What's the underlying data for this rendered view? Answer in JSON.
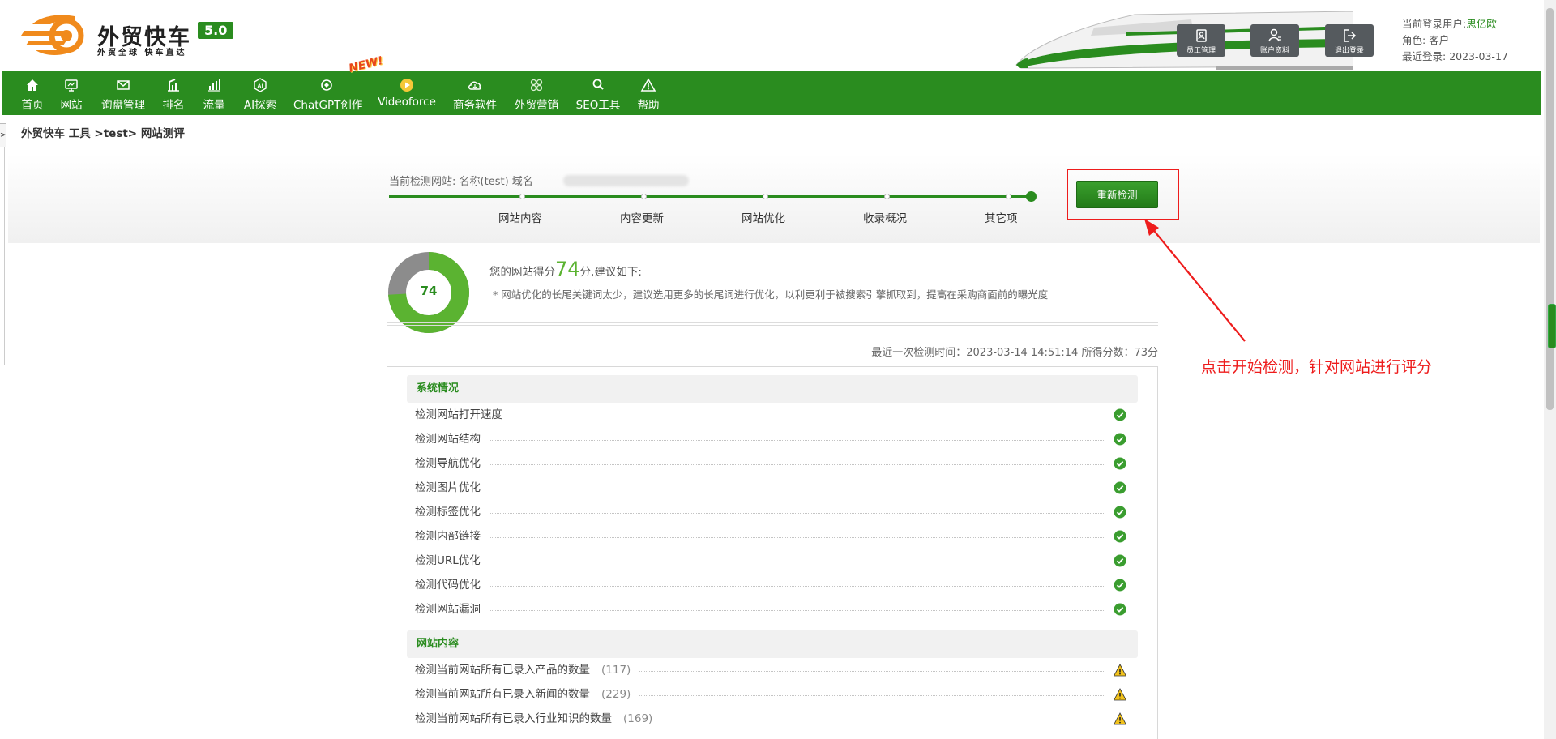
{
  "brand": {
    "name": "外贸快车",
    "version": "5.0",
    "slogan": "外贸全球 快车直达"
  },
  "header_buttons": [
    {
      "label": "员工管理",
      "icon": "staff-icon"
    },
    {
      "label": "账户资料",
      "icon": "account-icon"
    },
    {
      "label": "退出登录",
      "icon": "logout-icon"
    }
  ],
  "user": {
    "login_label": "当前登录用户:",
    "login_name": "思亿欧",
    "role_label": "角色:",
    "role": "客户",
    "last_login_label": "最近登录:",
    "last_login": "2023-03-17"
  },
  "nav": [
    {
      "label": "首页",
      "icon": "home-icon"
    },
    {
      "label": "网站",
      "icon": "monitor-icon"
    },
    {
      "label": "询盘管理",
      "icon": "mail-icon"
    },
    {
      "label": "排名",
      "icon": "ranking-icon"
    },
    {
      "label": "流量",
      "icon": "bar-chart-icon"
    },
    {
      "label": "AI探索",
      "icon": "ai-icon"
    },
    {
      "label": "ChatGPT创作",
      "icon": "chatgpt-icon"
    },
    {
      "label": "Videoforce",
      "icon": "video-icon"
    },
    {
      "label": "商务软件",
      "icon": "cloud-icon"
    },
    {
      "label": "外贸营销",
      "icon": "marketing-icon"
    },
    {
      "label": "SEO工具",
      "icon": "search-icon"
    },
    {
      "label": "帮助",
      "icon": "warning-icon"
    }
  ],
  "new_badge": "NEW!",
  "side_tab": ">",
  "breadcrumb": "外贸快车 工具 >test> 网站测评",
  "current_site": {
    "label": "当前检测网站:",
    "name_label": "名称",
    "name": "(test)",
    "domain_label": "域名"
  },
  "steps": [
    "网站内容",
    "内容更新",
    "网站优化",
    "收录概况",
    "其它项"
  ],
  "recheck_button": "重新检测",
  "annotation": "点击开始检测，针对网站进行评分",
  "score": {
    "value": 74,
    "prefix": "您的网站得分",
    "suffix": "分,建议如下:",
    "suggestion": "* 网站优化的长尾关键词太少，建议选用更多的长尾词进行优化，以利更利于被搜索引擎抓取到，提高在采购商面前的曝光度"
  },
  "last_check": "最近一次检测时间：2023-03-14 14:51:14 所得分数：73分",
  "sections": [
    {
      "title": "系统情况",
      "items": [
        {
          "label": "检测网站打开速度",
          "status": "ok"
        },
        {
          "label": "检测网站结构",
          "status": "ok"
        },
        {
          "label": "检测导航优化",
          "status": "ok"
        },
        {
          "label": "检测图片优化",
          "status": "ok"
        },
        {
          "label": "检测标签优化",
          "status": "ok"
        },
        {
          "label": "检测内部链接",
          "status": "ok"
        },
        {
          "label": "检测URL优化",
          "status": "ok"
        },
        {
          "label": "检测代码优化",
          "status": "ok"
        },
        {
          "label": "检测网站漏洞",
          "status": "ok"
        }
      ]
    },
    {
      "title": "网站内容",
      "items": [
        {
          "label": "检测当前网站所有已录入产品的数量",
          "count": "(117)",
          "status": "warn"
        },
        {
          "label": "检测当前网站所有已录入新闻的数量",
          "count": "(229)",
          "status": "warn"
        },
        {
          "label": "检测当前网站所有已录入行业知识的数量",
          "count": "(169)",
          "status": "warn"
        }
      ]
    }
  ],
  "colors": {
    "brand_green": "#2a8c1f",
    "score_green": "#5bb331",
    "annotation_red": "#ee1c1c",
    "logo_orange": "#f08a1c"
  }
}
